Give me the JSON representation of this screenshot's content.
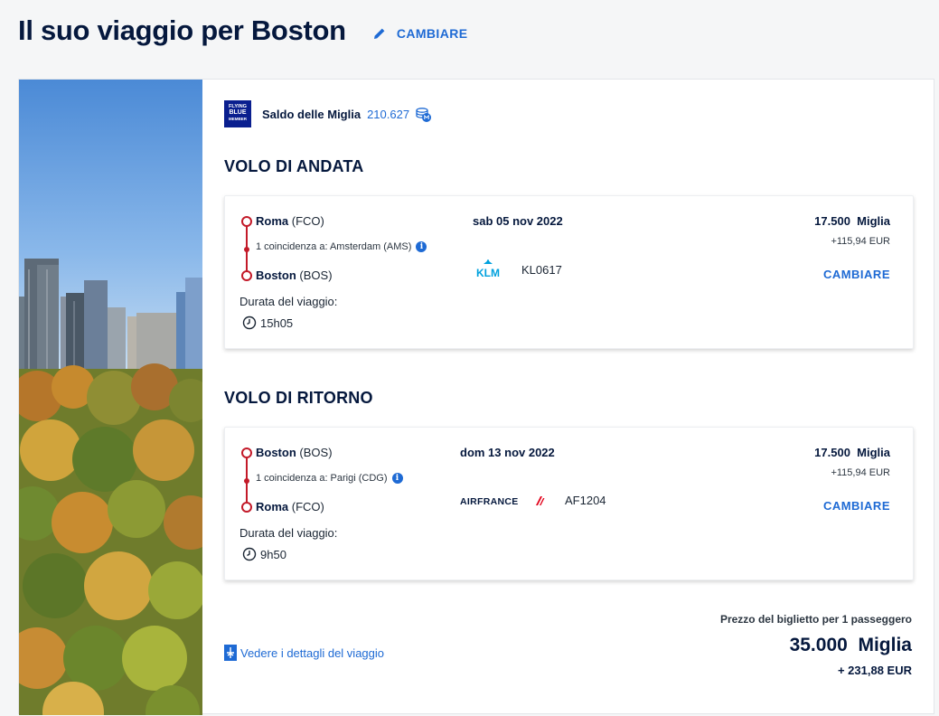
{
  "header": {
    "title": "Il suo viaggio per Boston",
    "change_label": "CAMBIARE"
  },
  "hero": {
    "icon": "boston-skyline-photo"
  },
  "balance": {
    "logo_lines": [
      "FLYING",
      "BLUE",
      "MEMBER"
    ],
    "label": "Saldo delle Miglia",
    "value": "210.627"
  },
  "outbound": {
    "section_title": "VOLO DI ANDATA",
    "origin_city": "Roma",
    "origin_code": "(FCO)",
    "stop": "1 coincidenza a: Amsterdam (AMS)",
    "dest_city": "Boston",
    "dest_code": "(BOS)",
    "duration_label": "Durata del viaggio:",
    "duration": "15h05",
    "date": "sab 05 nov 2022",
    "airline": "KLM",
    "flight_number": "KL0617",
    "miles": "17.500",
    "miles_unit": "Miglia",
    "eur": "+115,94 EUR",
    "change_label": "CAMBIARE"
  },
  "return": {
    "section_title": "VOLO DI RITORNO",
    "origin_city": "Boston",
    "origin_code": "(BOS)",
    "stop": "1 coincidenza a: Parigi (CDG)",
    "dest_city": "Roma",
    "dest_code": "(FCO)",
    "duration_label": "Durata del viaggio:",
    "duration": "9h50",
    "date": "dom 13 nov 2022",
    "airline": "AIRFRANCE",
    "flight_number": "AF1204",
    "miles": "17.500",
    "miles_unit": "Miglia",
    "eur": "+115,94 EUR",
    "change_label": "CAMBIARE"
  },
  "details_link": "Vedere i dettagli del viaggio",
  "total": {
    "label": "Prezzo del biglietto per 1 passeggero",
    "miles": "35.000",
    "miles_unit": "Miglia",
    "eur": "+ 231,88 EUR"
  },
  "colors": {
    "brand_navy": "#05183d",
    "link_blue": "#1e6ad4",
    "route_red": "#c31a29",
    "klm_blue": "#00a1de",
    "airfrance_red": "#e2001a"
  }
}
